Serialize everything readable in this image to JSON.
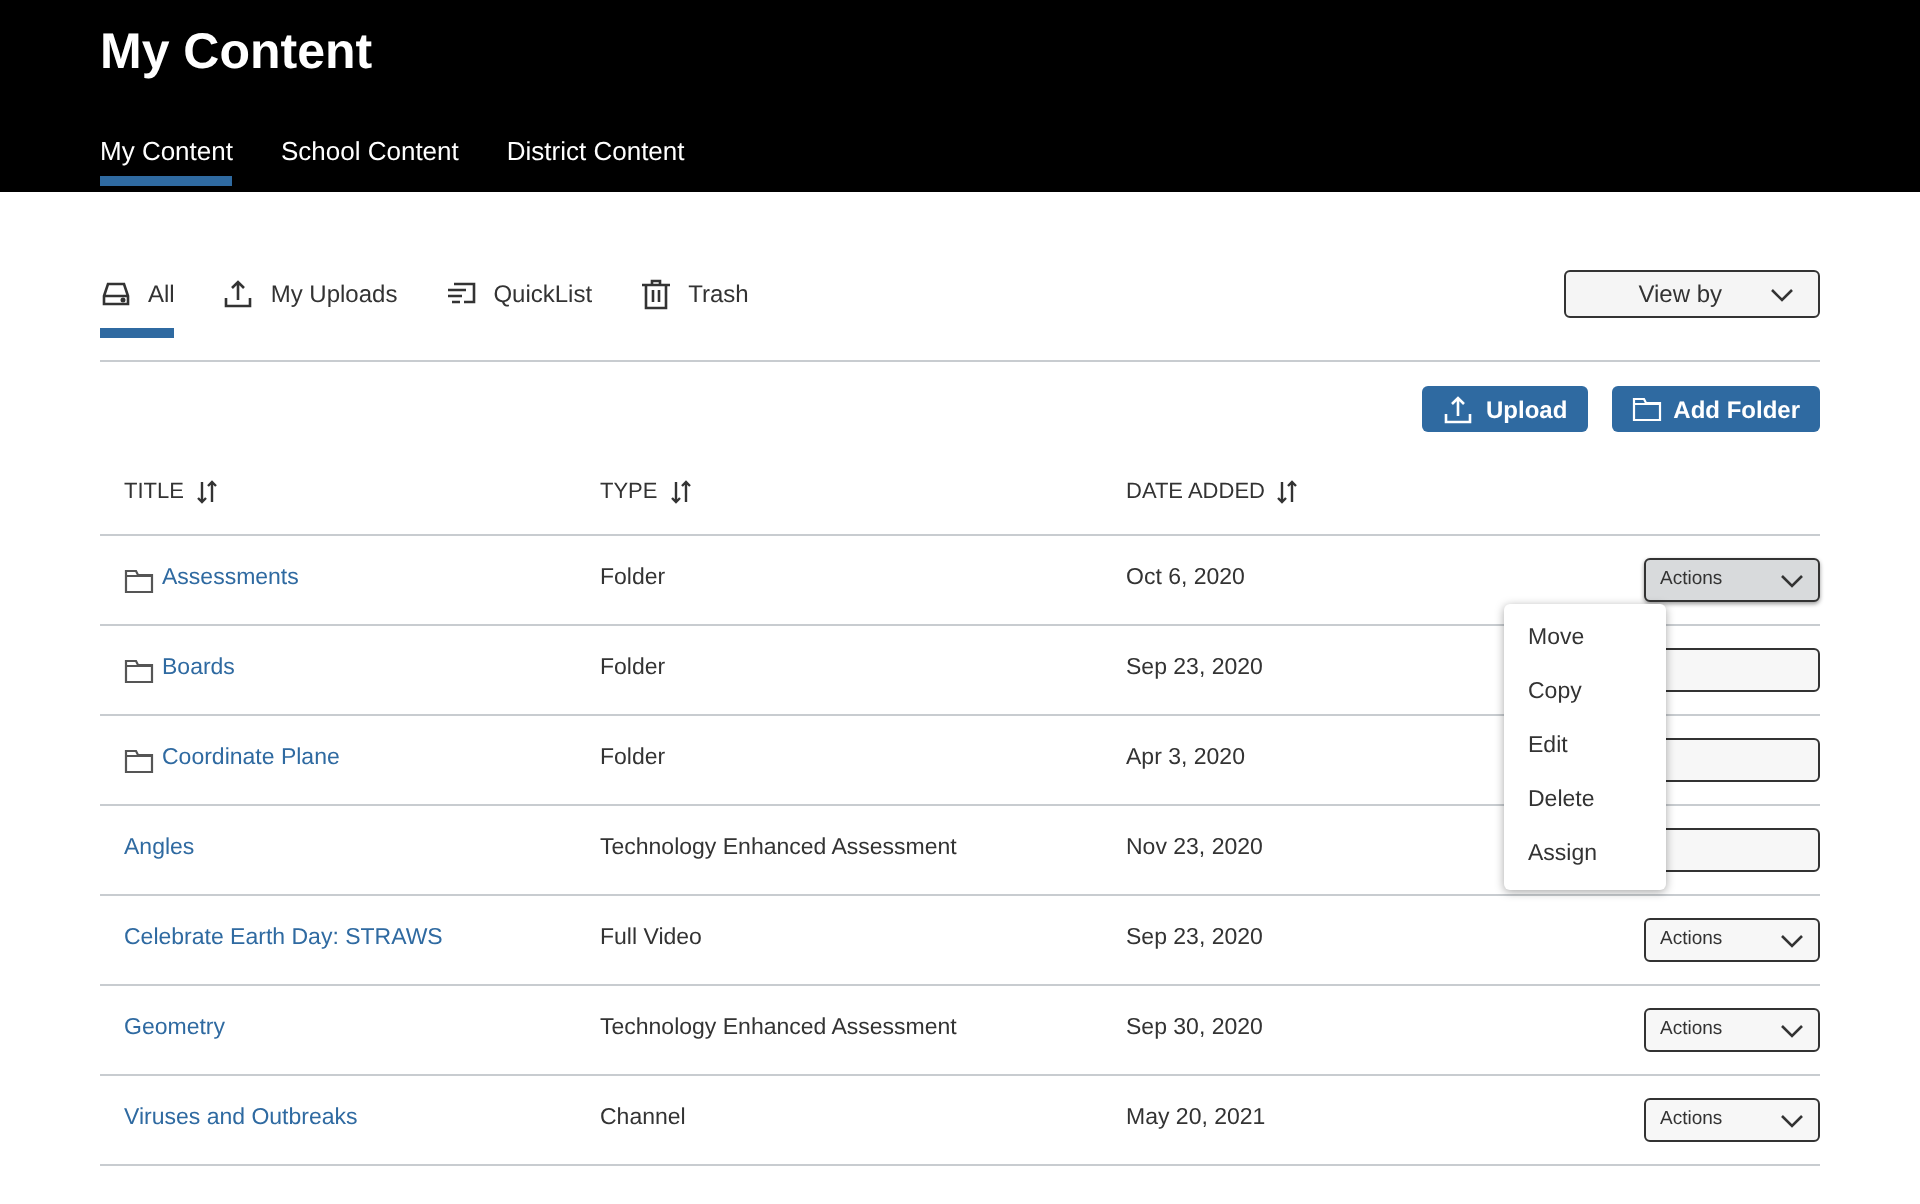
{
  "header": {
    "title": "My Content",
    "tabs": [
      {
        "label": "My Content",
        "selected": true
      },
      {
        "label": "School Content",
        "selected": false
      },
      {
        "label": "District Content",
        "selected": false
      }
    ]
  },
  "filters": [
    {
      "label": "All",
      "selected": true
    },
    {
      "label": "My Uploads",
      "selected": false
    },
    {
      "label": "QuickList",
      "selected": false
    },
    {
      "label": "Trash",
      "selected": false
    }
  ],
  "view_by": "View by",
  "buttons": [
    "Upload",
    "Add Folder"
  ],
  "table": {
    "columns": [
      "TITLE",
      "TYPE",
      "DATE ADDED"
    ],
    "rows": [
      {
        "title": "Assessments",
        "kind": "folder",
        "type": "Folder",
        "date": "Oct 6, 2020",
        "actions": "Actions",
        "open": true
      },
      {
        "title": "Boards",
        "kind": "folder",
        "type": "Folder",
        "date": "Sep 23, 2020",
        "open": false
      },
      {
        "title": "Coordinate Plane",
        "kind": "folder",
        "type": "Folder",
        "date": "Apr 3, 2020",
        "open": false
      },
      {
        "title": "Angles",
        "kind": "item",
        "type": "Technology Enhanced Assessment",
        "date": "Nov 23, 2020",
        "open": false
      },
      {
        "title": "Celebrate Earth Day: STRAWS",
        "kind": "item",
        "type": "Full Video",
        "date": "Sep 23, 2020",
        "actions": "Actions",
        "open": false
      },
      {
        "title": "Geometry",
        "kind": "item",
        "type": "Technology Enhanced Assessment",
        "date": "Sep 30, 2020",
        "actions": "Actions",
        "open": false
      },
      {
        "title": "Viruses and Outbreaks",
        "kind": "item",
        "type": "Channel",
        "date": "May 20, 2021",
        "actions": "Actions",
        "open": false
      }
    ]
  },
  "actions_menu": [
    "Move",
    "Copy",
    "Edit",
    "Delete",
    "Assign"
  ]
}
